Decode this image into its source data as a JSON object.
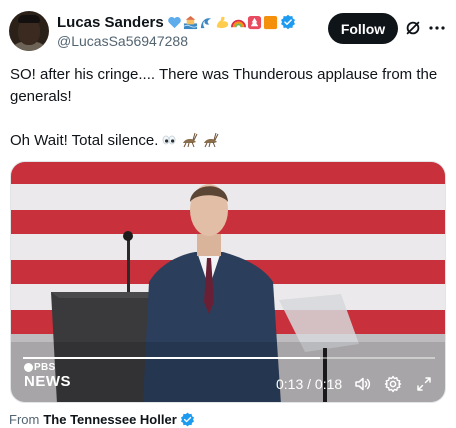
{
  "author": {
    "display_name": "Lucas Sanders",
    "handle": "@LucasSa56947288",
    "name_emojis": [
      "blue-heart",
      "ocean-house",
      "wave",
      "flexed-biceps",
      "rainbow",
      "tree-box",
      "orange-square"
    ]
  },
  "actions": {
    "follow_label": "Follow"
  },
  "post": {
    "line1": "SO! after his cringe.... There was Thunderous applause from the generals!",
    "line2": "Oh Wait! Total silence.",
    "line2_emojis": [
      "eyes",
      "cricket",
      "cricket"
    ]
  },
  "video": {
    "logo_top": "PBS",
    "logo_bottom": "NEWS",
    "time_display": "0:13 / 0:18",
    "progress_fraction": 0.72
  },
  "source": {
    "prefix": "From",
    "name": "The Tennessee Holler"
  },
  "colors": {
    "accent_verified": "#1d9bf0",
    "text_primary": "#0f1419",
    "text_secondary": "#536471",
    "flag_red": "#c8303b"
  }
}
